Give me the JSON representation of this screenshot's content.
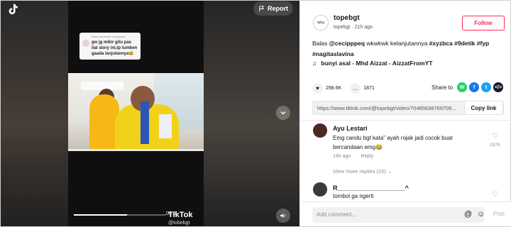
{
  "video": {
    "report_label": "Report",
    "reply_card": {
      "header": "Balas komentar cecipppeq",
      "text": "gw jg mikir gitu pas liat story ini,tp tumben gaada lanjutannya😆"
    },
    "time": "00:0",
    "watermark": "TikTok",
    "watermark_user": "@tobebgt",
    "progress": 0.58
  },
  "post": {
    "author": "topebgt",
    "author_sub": "topebgt · 21h ago",
    "avatar_text": "tpbg",
    "follow_label": "Follow",
    "caption_prefix": "Balas ",
    "caption_mention": "@cecipppeq",
    "caption_text": " wkwkwk kelanjutannya ",
    "caption_tags": "#xyzbca #9detik #fyp",
    "caption_tags2": "#nagitaslavina",
    "music": "bunyi asal - Mhd Aizzat - AizzatFromYT",
    "likes": "298.6K",
    "comments": "1871",
    "share_label": "Share to",
    "link_url": "https://www.tiktok.com/@topebgt/video/70485638769709...",
    "copy_label": "Copy link"
  },
  "comments": [
    {
      "name": "Ayu Lestari",
      "text": "Emg candu bgt kata\" ayah rojak jadi cocok buat bercandaan emg😂",
      "time": "14h ago",
      "reply_label": "Reply",
      "likes": "2378",
      "more_replies": "View more replies (10)"
    },
    {
      "name": "R___________________^",
      "text": "tombol ga ngerti"
    }
  ],
  "add_comment": {
    "placeholder": "Add comment...",
    "post_label": "Post"
  },
  "colors": {
    "accent": "#fe2c55",
    "whatsapp": "#25d366",
    "facebook": "#1877f2",
    "twitter": "#1da1f2",
    "embed": "#161823"
  }
}
